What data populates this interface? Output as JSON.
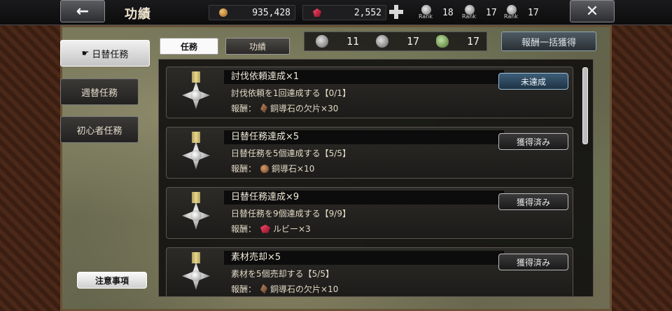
{
  "header": {
    "title": "功績",
    "back_icon": "arrow-left-icon",
    "close_icon": "close-icon",
    "gold": "935,428",
    "ruby": "2,552",
    "ranks": [
      {
        "label": "Rank",
        "value": "18",
        "icon": "rank-skull-icon"
      },
      {
        "label": "Rank",
        "value": "17",
        "icon": "rank-flower-icon"
      },
      {
        "label": "Rank",
        "value": "17",
        "icon": "rank-beast-icon"
      }
    ]
  },
  "categories": [
    {
      "label": "日替任務",
      "selected": true
    },
    {
      "label": "週替任務",
      "selected": false
    },
    {
      "label": "初心者任務",
      "selected": false
    }
  ],
  "notice_label": "注意事項",
  "tabs": [
    {
      "label": "任務",
      "selected": true
    },
    {
      "label": "功績",
      "selected": false
    }
  ],
  "counters": [
    {
      "icon": "emblem-icon",
      "value": "11"
    },
    {
      "icon": "gear-emblem-icon",
      "value": "17"
    },
    {
      "icon": "clover-icon",
      "value": "17"
    }
  ],
  "claim_all_label": "報酬一括獲得",
  "quests": [
    {
      "title": "討伐依頼達成×1",
      "desc": "討伐依頼を1回達成する【0/1】",
      "reward_label": "報酬：",
      "reward_icon": "copper-shard-icon",
      "reward": "銅導石の欠片×30",
      "status": "未達成"
    },
    {
      "title": "日替任務達成×5",
      "desc": "日替任務を5個達成する【5/5】",
      "reward_label": "報酬：",
      "reward_icon": "copper-stone-icon",
      "reward": "銅導石×10",
      "status": "獲得済み"
    },
    {
      "title": "日替任務達成×9",
      "desc": "日替任務を9個達成する【9/9】",
      "reward_label": "報酬：",
      "reward_icon": "ruby-icon",
      "reward": "ルビー×3",
      "status": "獲得済み"
    },
    {
      "title": "素材売却×5",
      "desc": "素材を5個売却する【5/5】",
      "reward_label": "報酬：",
      "reward_icon": "copper-shard-icon",
      "reward": "銅導石の欠片×10",
      "status": "獲得済み"
    }
  ],
  "colors": {
    "accent_pending": "#3d5e78",
    "ruby": "#e0304e",
    "gold": "#d79a40"
  }
}
